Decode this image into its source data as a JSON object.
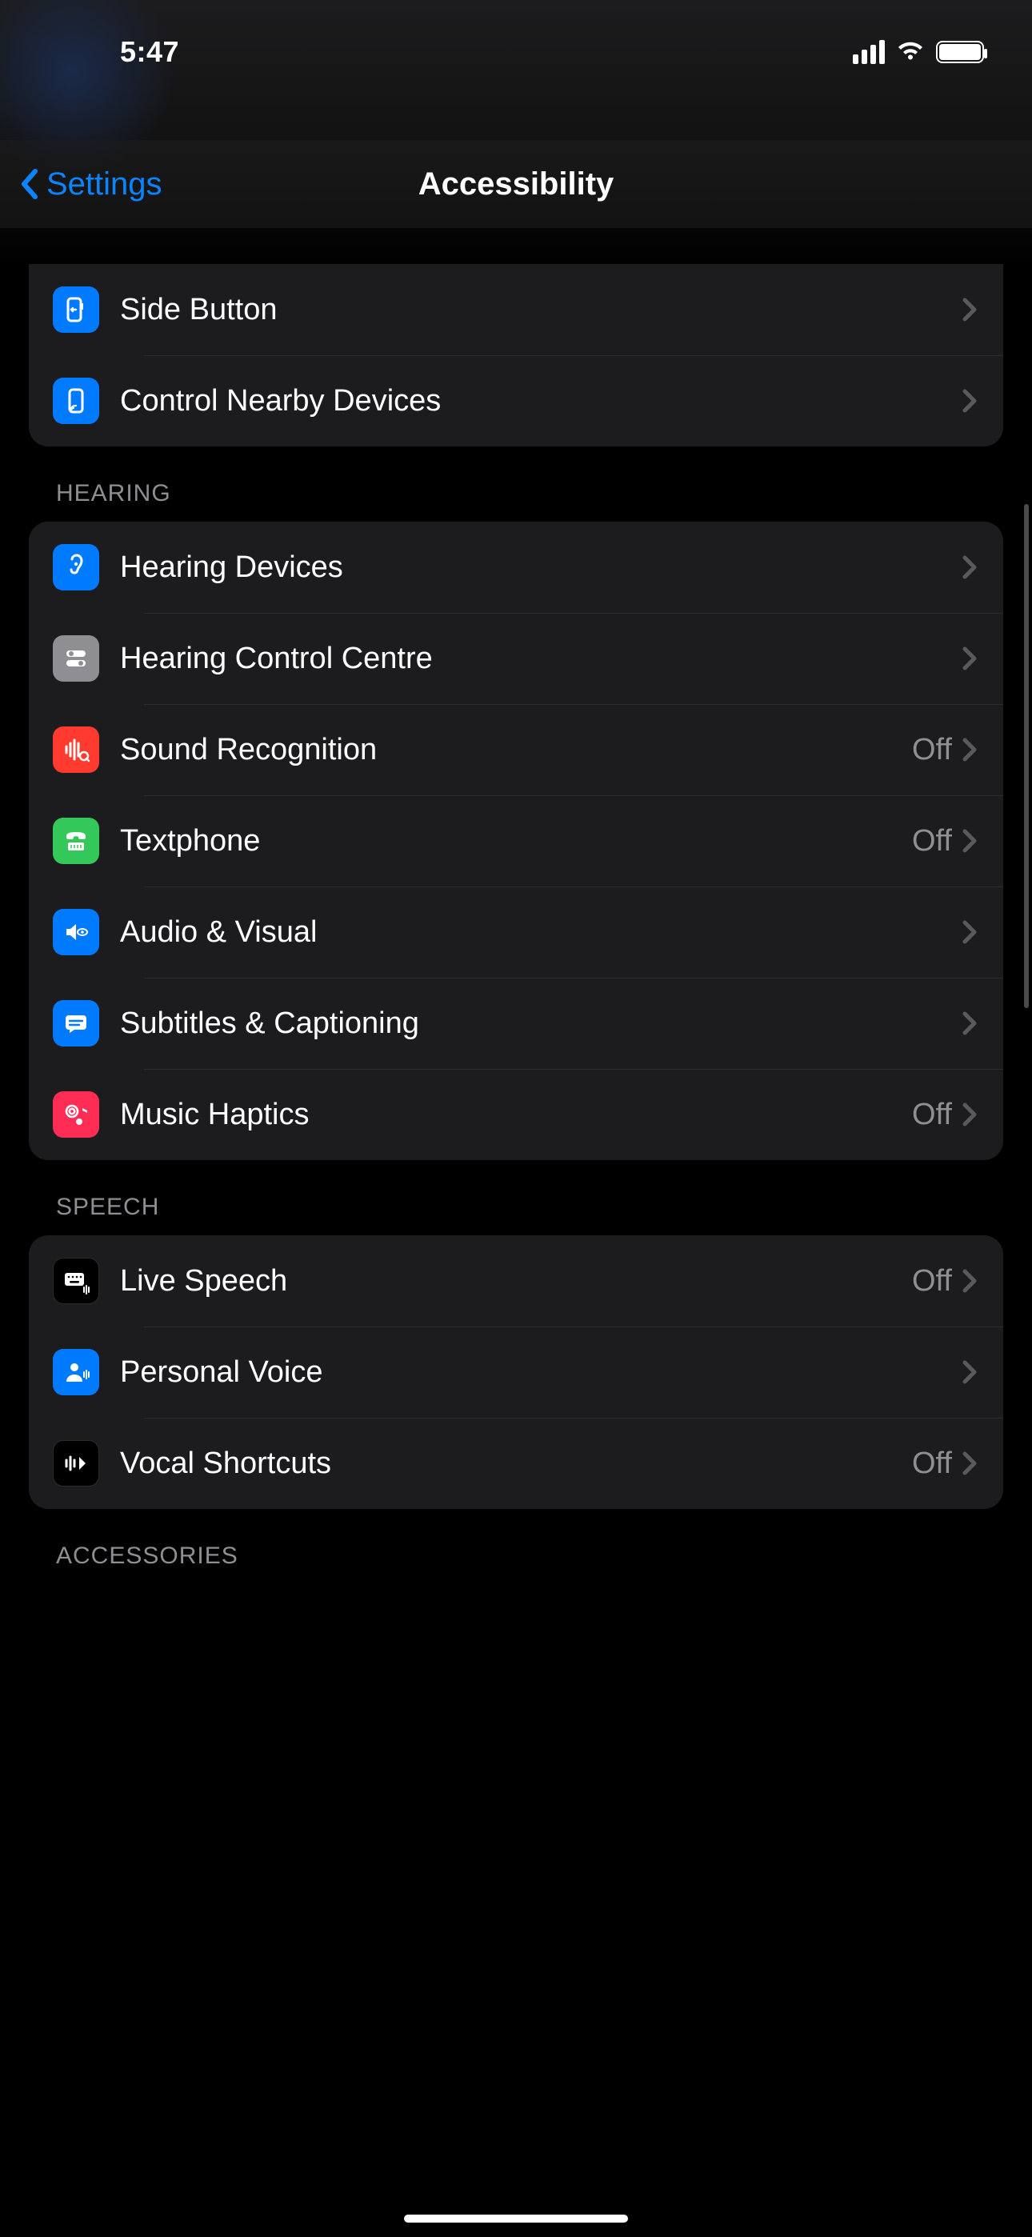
{
  "status": {
    "time": "5:47"
  },
  "nav": {
    "back": "Settings",
    "title": "Accessibility"
  },
  "groups": [
    {
      "partialTop": true,
      "rows": [
        {
          "icon": "side-button-icon",
          "iconClass": "bg-blue",
          "label": "Side Button",
          "value": ""
        },
        {
          "icon": "nearby-devices-icon",
          "iconClass": "bg-blue",
          "label": "Control Nearby Devices",
          "value": ""
        }
      ]
    },
    {
      "header": "HEARING",
      "rows": [
        {
          "icon": "ear-icon",
          "iconClass": "bg-blue",
          "label": "Hearing Devices",
          "value": ""
        },
        {
          "icon": "switches-icon",
          "iconClass": "bg-grey",
          "label": "Hearing Control Centre",
          "value": ""
        },
        {
          "icon": "soundwave-icon",
          "iconClass": "bg-red",
          "label": "Sound Recognition",
          "value": "Off"
        },
        {
          "icon": "textphone-icon",
          "iconClass": "bg-green",
          "label": "Textphone",
          "value": "Off"
        },
        {
          "icon": "speaker-eye-icon",
          "iconClass": "bg-blue",
          "label": "Audio & Visual",
          "value": ""
        },
        {
          "icon": "caption-icon",
          "iconClass": "bg-blue",
          "label": "Subtitles & Captioning",
          "value": ""
        },
        {
          "icon": "music-note-icon",
          "iconClass": "bg-pink",
          "label": "Music Haptics",
          "value": "Off"
        }
      ]
    },
    {
      "header": "SPEECH",
      "rows": [
        {
          "icon": "keyboard-icon",
          "iconClass": "bg-black",
          "label": "Live Speech",
          "value": "Off"
        },
        {
          "icon": "person-voice-icon",
          "iconClass": "bg-blue",
          "label": "Personal Voice",
          "value": ""
        },
        {
          "icon": "vocal-shortcut-icon",
          "iconClass": "bg-black",
          "label": "Vocal Shortcuts",
          "value": "Off"
        }
      ]
    },
    {
      "header": "ACCESSORIES",
      "rows": []
    }
  ]
}
